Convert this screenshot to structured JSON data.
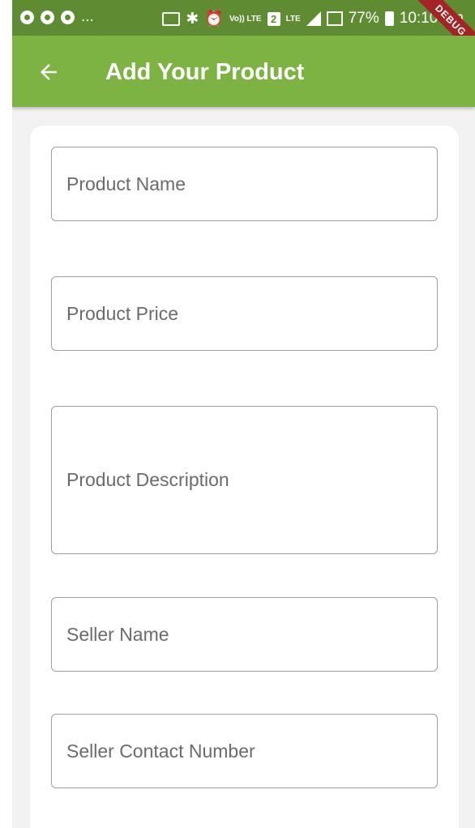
{
  "status_bar": {
    "battery": "77%",
    "time": "10:10 am",
    "ellipsis": "...",
    "sim": "2",
    "volte": "Vo)) LTE",
    "lte": "LTE"
  },
  "app_bar": {
    "title": "Add Your Product"
  },
  "debug_banner": "DEBUG",
  "form": {
    "fields": [
      {
        "placeholder": "Product Name"
      },
      {
        "placeholder": "Product Price"
      },
      {
        "placeholder": "Product Description"
      },
      {
        "placeholder": "Seller Name"
      },
      {
        "placeholder": "Seller Contact Number"
      }
    ]
  },
  "colors": {
    "status_bar": "#5f8c33",
    "app_bar": "#7cb342",
    "background": "#f2f2f2",
    "card": "#ffffff",
    "field_border": "#9e9e9e",
    "placeholder_text": "#6b6b6b"
  }
}
